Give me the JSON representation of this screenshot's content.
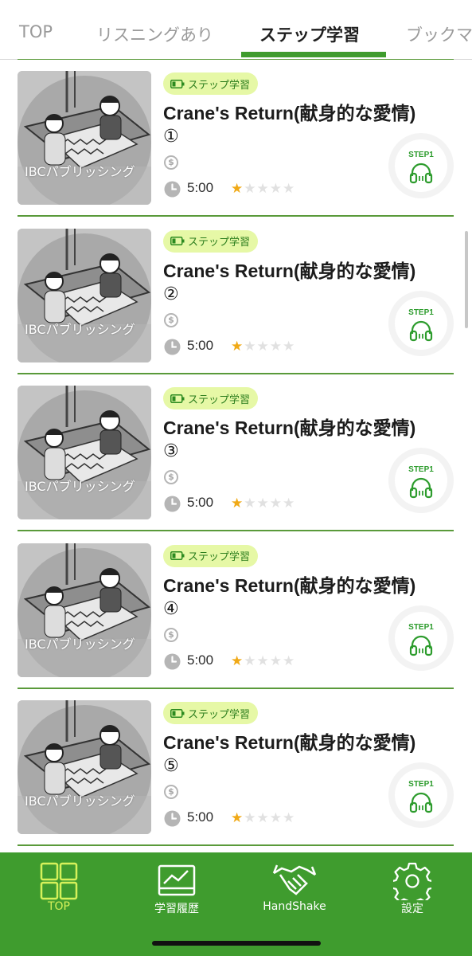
{
  "tabs": [
    {
      "label": "TOP",
      "active": false
    },
    {
      "label": "リスニングあり",
      "active": false
    },
    {
      "label": "ステップ学習",
      "active": true
    },
    {
      "label": "ブックマ",
      "active": false
    }
  ],
  "items": [
    {
      "badge": "ステップ学習",
      "title": "Crane's Return(献身的な愛情)",
      "number": "①",
      "publisher": "IBCパブリッシング",
      "price_icon": "$",
      "duration": "5:00",
      "difficulty": 1,
      "difficulty_max": 5,
      "step": "STEP1",
      "step_icon": "headphones-icon"
    },
    {
      "badge": "ステップ学習",
      "title": "Crane's Return(献身的な愛情)",
      "number": "②",
      "publisher": "IBCパブリッシング",
      "price_icon": "$",
      "duration": "5:00",
      "difficulty": 1,
      "difficulty_max": 5,
      "step": "STEP1",
      "step_icon": "headphones-icon"
    },
    {
      "badge": "ステップ学習",
      "title": "Crane's Return(献身的な愛情)",
      "number": "③",
      "publisher": "IBCパブリッシング",
      "price_icon": "$",
      "duration": "5:00",
      "difficulty": 1,
      "difficulty_max": 5,
      "step": "STEP1",
      "step_icon": "headphones-icon"
    },
    {
      "badge": "ステップ学習",
      "title": "Crane's Return(献身的な愛情)",
      "number": "④",
      "publisher": "IBCパブリッシング",
      "price_icon": "$",
      "duration": "5:00",
      "difficulty": 1,
      "difficulty_max": 5,
      "step": "STEP1",
      "step_icon": "headphones-icon"
    },
    {
      "badge": "ステップ学習",
      "title": "Crane's Return(献身的な愛情)",
      "number": "⑤",
      "publisher": "IBCパブリッシング",
      "price_icon": "$",
      "duration": "5:00",
      "difficulty": 1,
      "difficulty_max": 5,
      "step": "STEP1",
      "step_icon": "headphones-icon"
    }
  ],
  "bottom_nav": [
    {
      "label": "TOP",
      "icon": "grid-icon",
      "active": true
    },
    {
      "label": "学習履歴",
      "icon": "chart-icon",
      "active": false
    },
    {
      "label": "HandShake",
      "icon": "handshake-icon",
      "active": false
    },
    {
      "label": "設定",
      "icon": "gear-icon",
      "active": false
    }
  ],
  "colors": {
    "accent_green": "#3f9c2e",
    "active_nav_label": "#d6f15a",
    "badge_bg": "#e6f8a6",
    "star_on": "#f0a916",
    "star_off": "#e1e1e1"
  }
}
